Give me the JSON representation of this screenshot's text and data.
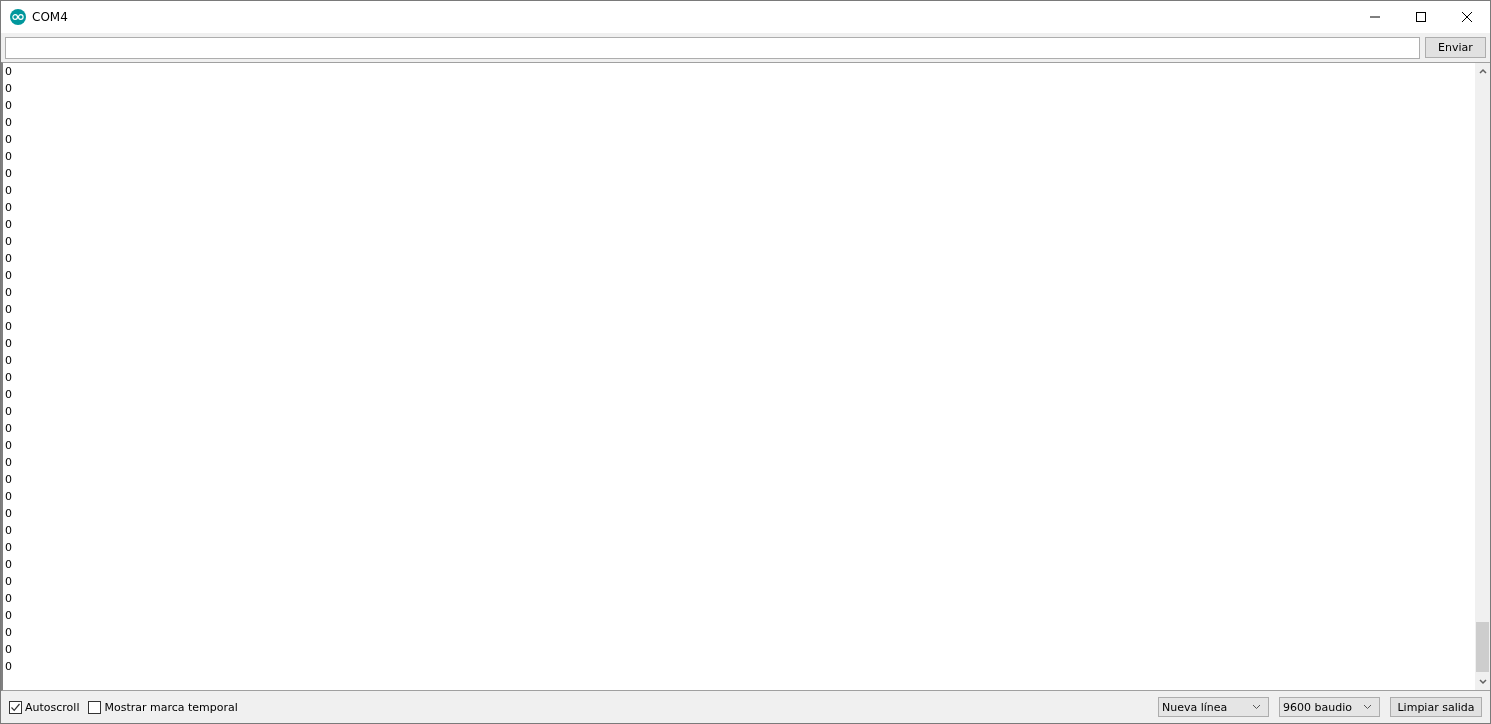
{
  "window": {
    "title": "COM4"
  },
  "send": {
    "button": "Enviar"
  },
  "output": {
    "lines": [
      "0",
      "0",
      "0",
      "0",
      "0",
      "0",
      "0",
      "0",
      "0",
      "0",
      "0",
      "0",
      "0",
      "0",
      "0",
      "0",
      "0",
      "0",
      "0",
      "0",
      "0",
      "0",
      "0",
      "0",
      "0",
      "0",
      "0",
      "0",
      "0",
      "0",
      "0",
      "0",
      "0",
      "0",
      "0",
      "0"
    ]
  },
  "options": [
    {
      "label": "Autoscroll",
      "checked": true
    },
    {
      "label": "Mostrar marca temporal",
      "checked": false
    }
  ],
  "line_ending": "Nueva línea",
  "baud_rate": "9600 baudio",
  "clear_button": "Limpiar salida"
}
